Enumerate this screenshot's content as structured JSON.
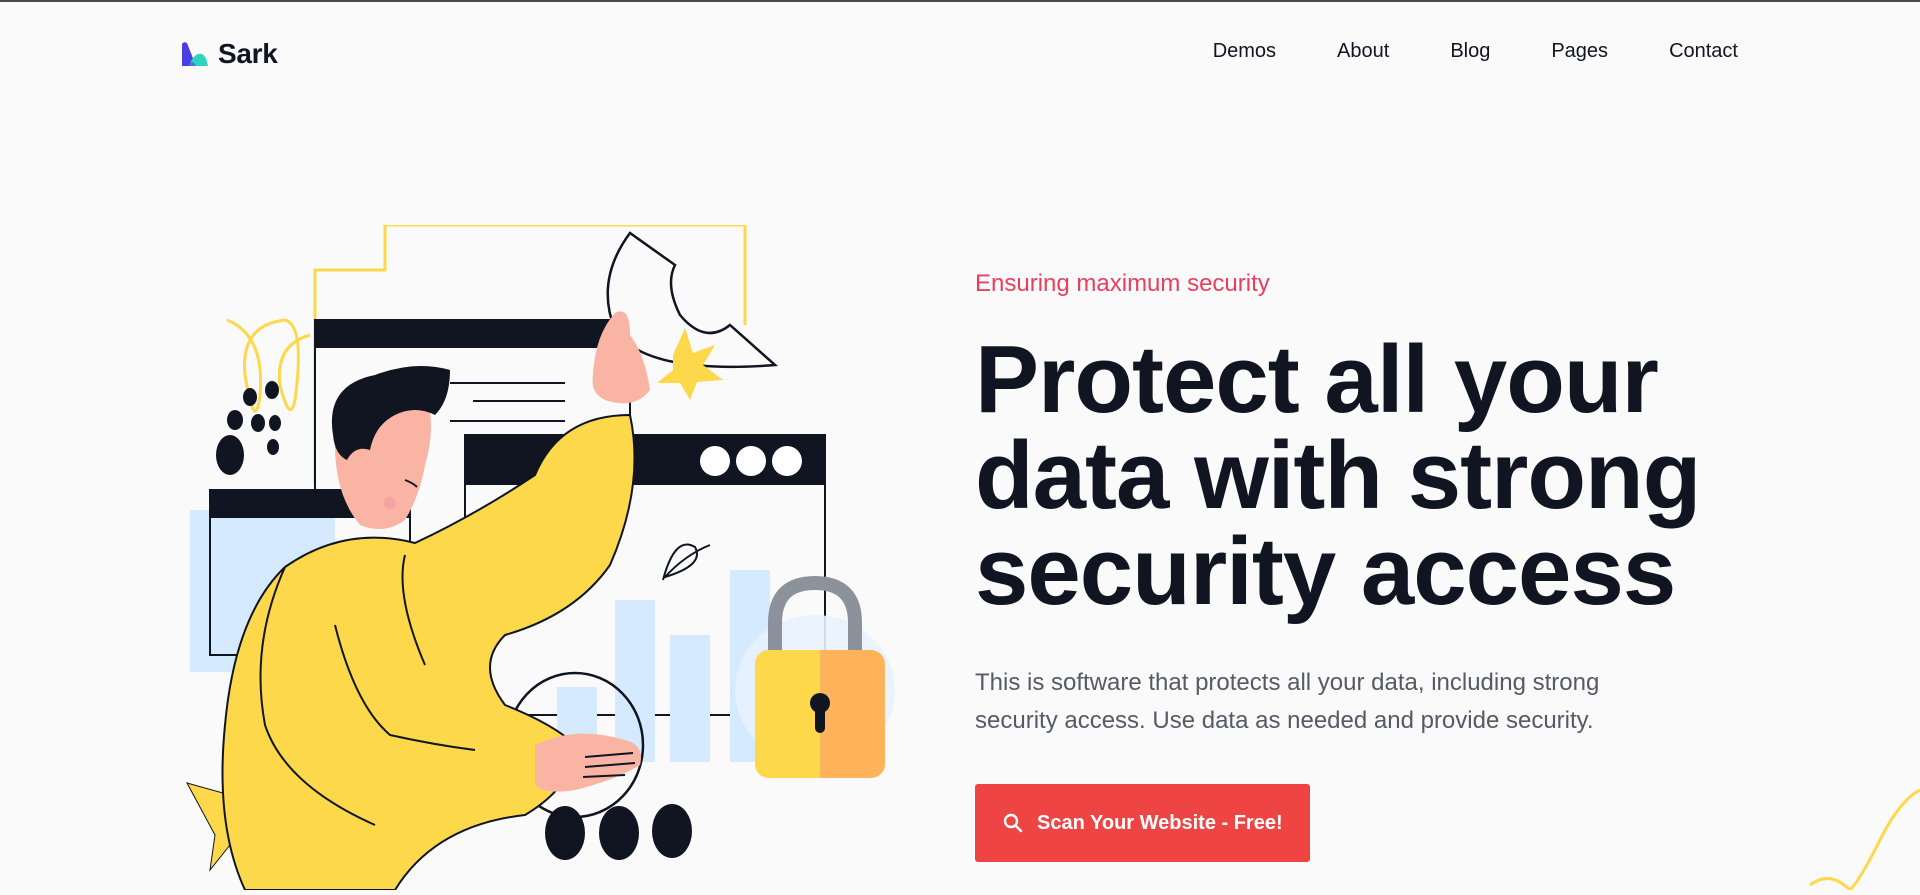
{
  "brand": {
    "name": "Sark"
  },
  "nav": {
    "items": [
      "Demos",
      "About",
      "Blog",
      "Pages",
      "Contact"
    ]
  },
  "hero": {
    "eyebrow": "Ensuring maximum security",
    "headline_lines": [
      "Protect all your",
      "data with strong",
      "security access"
    ],
    "description_lines": [
      "This is software that protects all your data, including strong",
      "security access. Use data as needed and provide security."
    ],
    "cta_label": "Scan Your Website - Free!"
  },
  "colors": {
    "accent": "#ee4444",
    "eyebrow": "#e93f5c",
    "text": "#111521",
    "muted": "#555a65",
    "background": "#fafafa",
    "yellow": "#fdd84a"
  },
  "icons": {
    "logo": "sark-fin-icon",
    "cta": "search-icon"
  }
}
